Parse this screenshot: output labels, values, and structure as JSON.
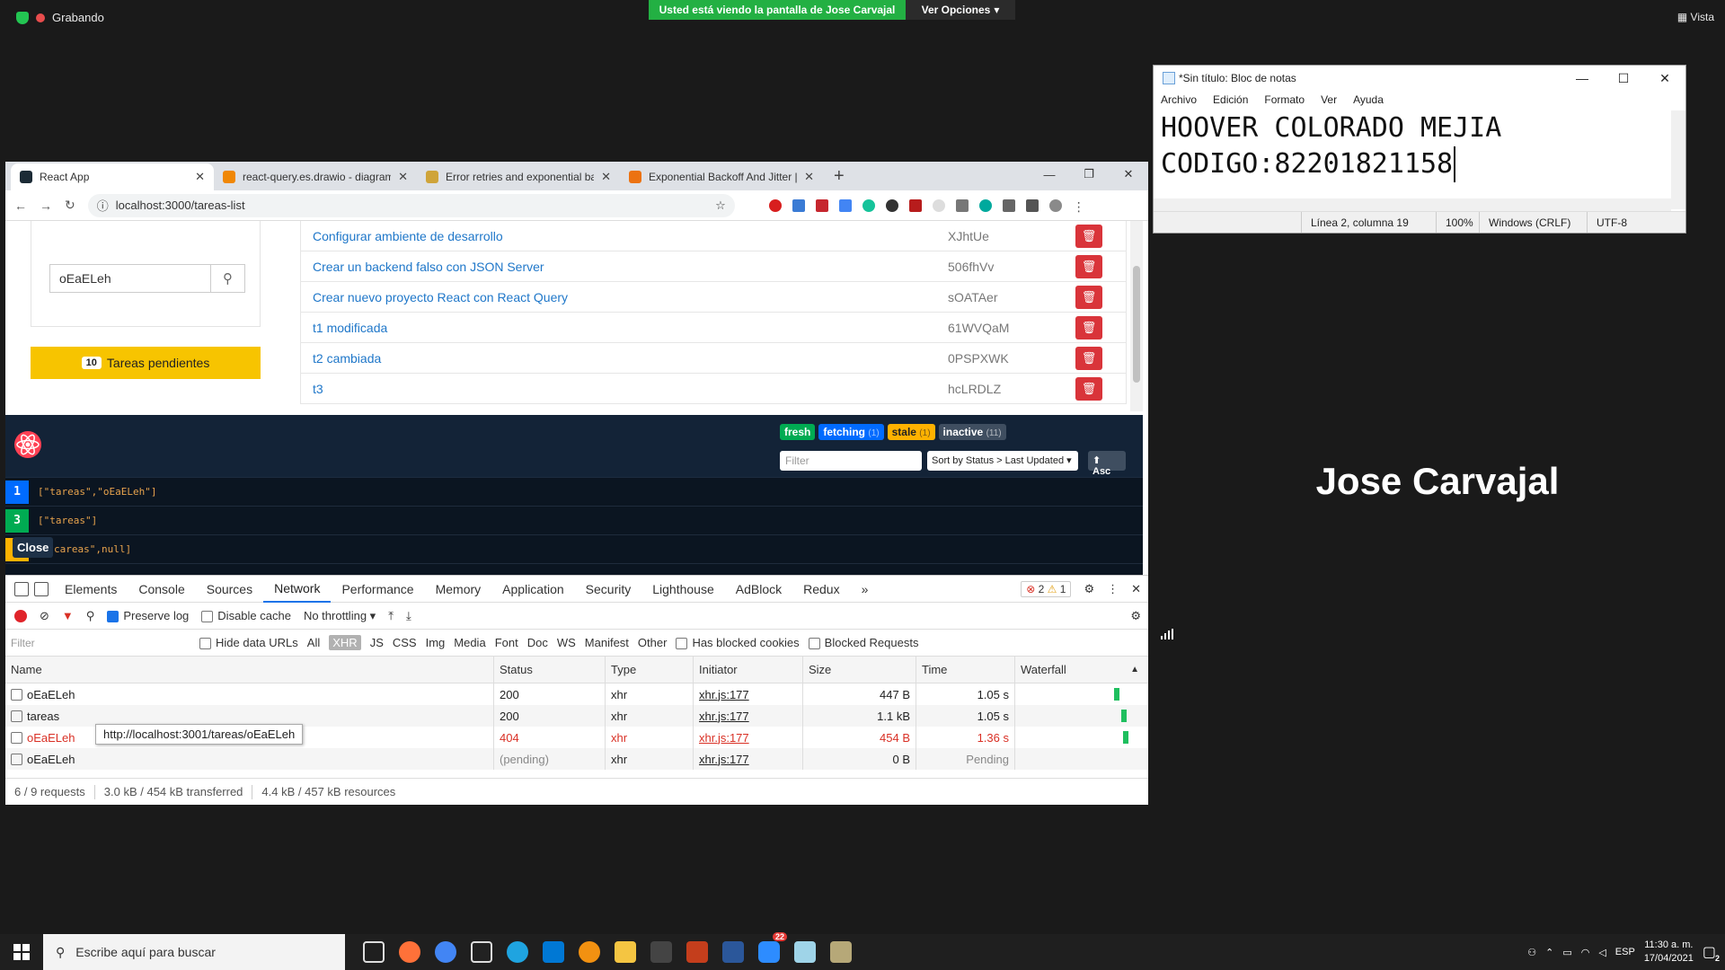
{
  "zoom": {
    "recording_label": "Grabando",
    "viewing_banner": "Usted está viendo la pantalla de Jose Carvajal",
    "options_label": "Ver Opciones",
    "view_label": "Vista",
    "participant_name": "Jose Carvajal"
  },
  "notepad": {
    "title": "*Sin título: Bloc de notas",
    "menu": [
      "Archivo",
      "Edición",
      "Formato",
      "Ver",
      "Ayuda"
    ],
    "lines": [
      "HOOVER COLORADO MEJIA",
      "CODIGO:82201821158"
    ],
    "status": {
      "position": "Línea 2, columna 19",
      "zoom": "100%",
      "eol": "Windows (CRLF)",
      "encoding": "UTF-8"
    }
  },
  "browser": {
    "tabs": [
      {
        "label": "React App",
        "color": "#00b4d8"
      },
      {
        "label": "react-query.es.drawio - diagrams.net",
        "color": "#f08705"
      },
      {
        "label": "Error retries and exponential backoff",
        "color": "#cfa43a"
      },
      {
        "label": "Exponential Backoff And Jitter | AWS",
        "color": "#ec7211"
      }
    ],
    "url": "localhost:3000/tareas-list"
  },
  "app": {
    "search_value": "oEaELeh",
    "pending_count": "10",
    "pending_label": "Tareas pendientes",
    "tasks": [
      {
        "title": "Configurar ambiente de desarrollo",
        "id": "XJhtUe"
      },
      {
        "title": "Crear un backend falso con JSON Server",
        "id": "506fhVv"
      },
      {
        "title": "Crear nuevo proyecto React con React Query",
        "id": "sOATAer"
      },
      {
        "title": "t1 modificada",
        "id": "61WVQaM"
      },
      {
        "title": "t2 cambiada",
        "id": "0PSPXWK"
      },
      {
        "title": "t3",
        "id": "hcLRDLZ"
      }
    ]
  },
  "rq_devtools": {
    "pills": [
      {
        "label": "fresh",
        "count": "",
        "color": "#00ab52"
      },
      {
        "label": "fetching",
        "count": "(1)",
        "color": "#006bff"
      },
      {
        "label": "stale",
        "count": "(1)",
        "color": "#ffb200"
      },
      {
        "label": "inactive",
        "count": "(11)",
        "color": "#3f4e60"
      }
    ],
    "filter_placeholder": "Filter",
    "sort_label": "Sort by Status > Last Updated",
    "asc_label": "⬆ Asc",
    "queries": [
      {
        "count": "1",
        "key": "[\"tareas\",\"oEaELeh\"]",
        "color": "#006bff"
      },
      {
        "count": "3",
        "key": "[\"tareas\"]",
        "color": "#00ab52"
      },
      {
        "count": "",
        "key": "careas\",null]",
        "color": "#ffb200"
      }
    ],
    "close_label": "Close"
  },
  "devtools": {
    "tabs": [
      "Elements",
      "Console",
      "Sources",
      "Network",
      "Performance",
      "Memory",
      "Application",
      "Security",
      "Lighthouse",
      "AdBlock",
      "Redux"
    ],
    "errors": "2",
    "warnings": "1",
    "preserve_log": "Preserve log",
    "disable_cache": "Disable cache",
    "throttling": "No throttling",
    "filter_placeholder": "Filter",
    "hide_data_urls": "Hide data URLs",
    "types": [
      "All",
      "XHR",
      "JS",
      "CSS",
      "Img",
      "Media",
      "Font",
      "Doc",
      "WS",
      "Manifest",
      "Other"
    ],
    "has_blocked": "Has blocked cookies",
    "blocked_requests": "Blocked Requests",
    "columns": [
      "Name",
      "Status",
      "Type",
      "Initiator",
      "Size",
      "Time",
      "Waterfall"
    ],
    "requests": [
      {
        "name": "oEaELeh",
        "status": "200",
        "type": "xhr",
        "initiator": "xhr.js:177",
        "size": "447 B",
        "time": "1.05 s",
        "error": false,
        "pending": false
      },
      {
        "name": "tareas",
        "status": "200",
        "type": "xhr",
        "initiator": "xhr.js:177",
        "size": "1.1 kB",
        "time": "1.05 s",
        "error": false,
        "pending": false
      },
      {
        "name": "oEaELeh",
        "status": "404",
        "type": "xhr",
        "initiator": "xhr.js:177",
        "size": "454 B",
        "time": "1.36 s",
        "error": true,
        "pending": false
      },
      {
        "name": "oEaELeh",
        "status": "(pending)",
        "type": "xhr",
        "initiator": "xhr.js:177",
        "size": "0 B",
        "time": "Pending",
        "error": false,
        "pending": true
      }
    ],
    "tooltip": "http://localhost:3001/tareas/oEaELeh",
    "summary": [
      "6 / 9 requests",
      "3.0 kB / 454 kB transferred",
      "4.4 kB / 457 kB resources"
    ]
  },
  "taskbar": {
    "search_placeholder": "Escribe aquí para buscar",
    "lang": "ESP",
    "time": "11:30 a. m.",
    "date": "17/04/2021",
    "badge": "22",
    "notifications": "2"
  }
}
